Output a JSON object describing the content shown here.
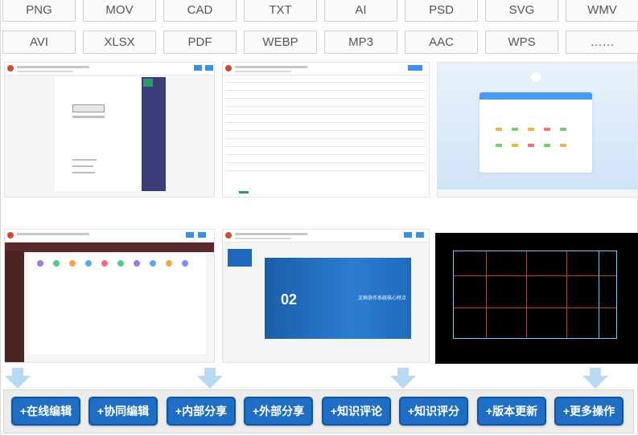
{
  "formats": {
    "row1": [
      "PNG",
      "MOV",
      "CAD",
      "TXT",
      "AI",
      "PSD",
      "SVG",
      "WMV"
    ],
    "row2": [
      "AVI",
      "XLSX",
      "PDF",
      "WEBP",
      "MP3",
      "AAC",
      "WPS",
      "……"
    ]
  },
  "previews": {
    "ppt_slide_number": "02",
    "ppt_slide_title": "文档协作系统核心特点"
  },
  "actions": [
    "+在线编辑",
    "+协同编辑",
    "+内部分享",
    "+外部分享",
    "+知识评论",
    "+知识评分",
    "+版本更新",
    "+更多操作"
  ],
  "colors": {
    "action_button": "#1f6ec4",
    "arrow": "#b7d9f4",
    "accent_blue": "#3b8fe8"
  }
}
